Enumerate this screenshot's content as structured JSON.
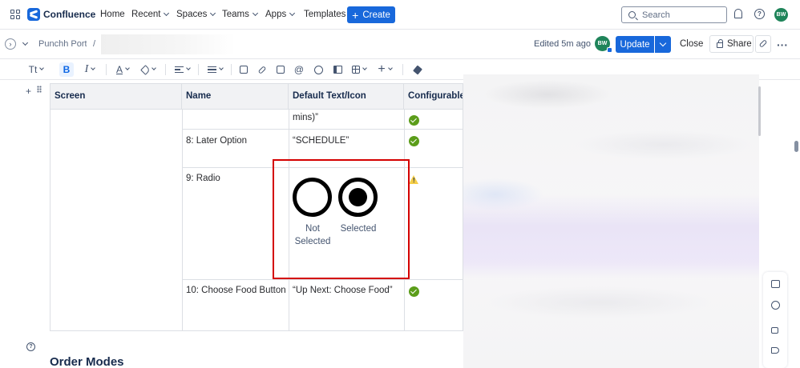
{
  "topnav": {
    "brand": "Confluence",
    "items": [
      "Home",
      "Recent",
      "Spaces",
      "Teams",
      "Apps",
      "Templates"
    ],
    "create_label": "Create",
    "search_placeholder": "Search",
    "user_initials": "BW"
  },
  "subheader": {
    "breadcrumb": "Punchh Portal",
    "breadcrumb_separator": "/",
    "edited": "Edited 5m ago",
    "collaborator_initials": "BW",
    "update_label": "Update",
    "close_label": "Close",
    "share_label": "Share"
  },
  "toolbar": {
    "text_style": "Tt",
    "bold": "B",
    "italic": "I",
    "text_color": "A"
  },
  "table": {
    "headers": [
      "Screen",
      "Name",
      "Default Text/Icon",
      "Configurable?"
    ],
    "rows": [
      {
        "name": "",
        "default_text": "mins)”",
        "configurable": "check"
      },
      {
        "name": "8: Later Option",
        "default_text": "“SCHEDULE”",
        "configurable": "check"
      },
      {
        "name": "9: Radio",
        "default_text": "",
        "configurable": "warning"
      },
      {
        "name": "10: Choose Food Button",
        "default_text": "“Up Next: Choose Food”",
        "configurable": "check"
      }
    ],
    "radio_labels": {
      "not_selected_line1": "Not",
      "not_selected_line2": "Selected",
      "selected": "Selected"
    }
  },
  "section_heading": "Order Modes",
  "colors": {
    "accent": "#1868db",
    "success": "#5b9d1a",
    "warning": "#f5cd47",
    "highlight": "#d40000"
  }
}
